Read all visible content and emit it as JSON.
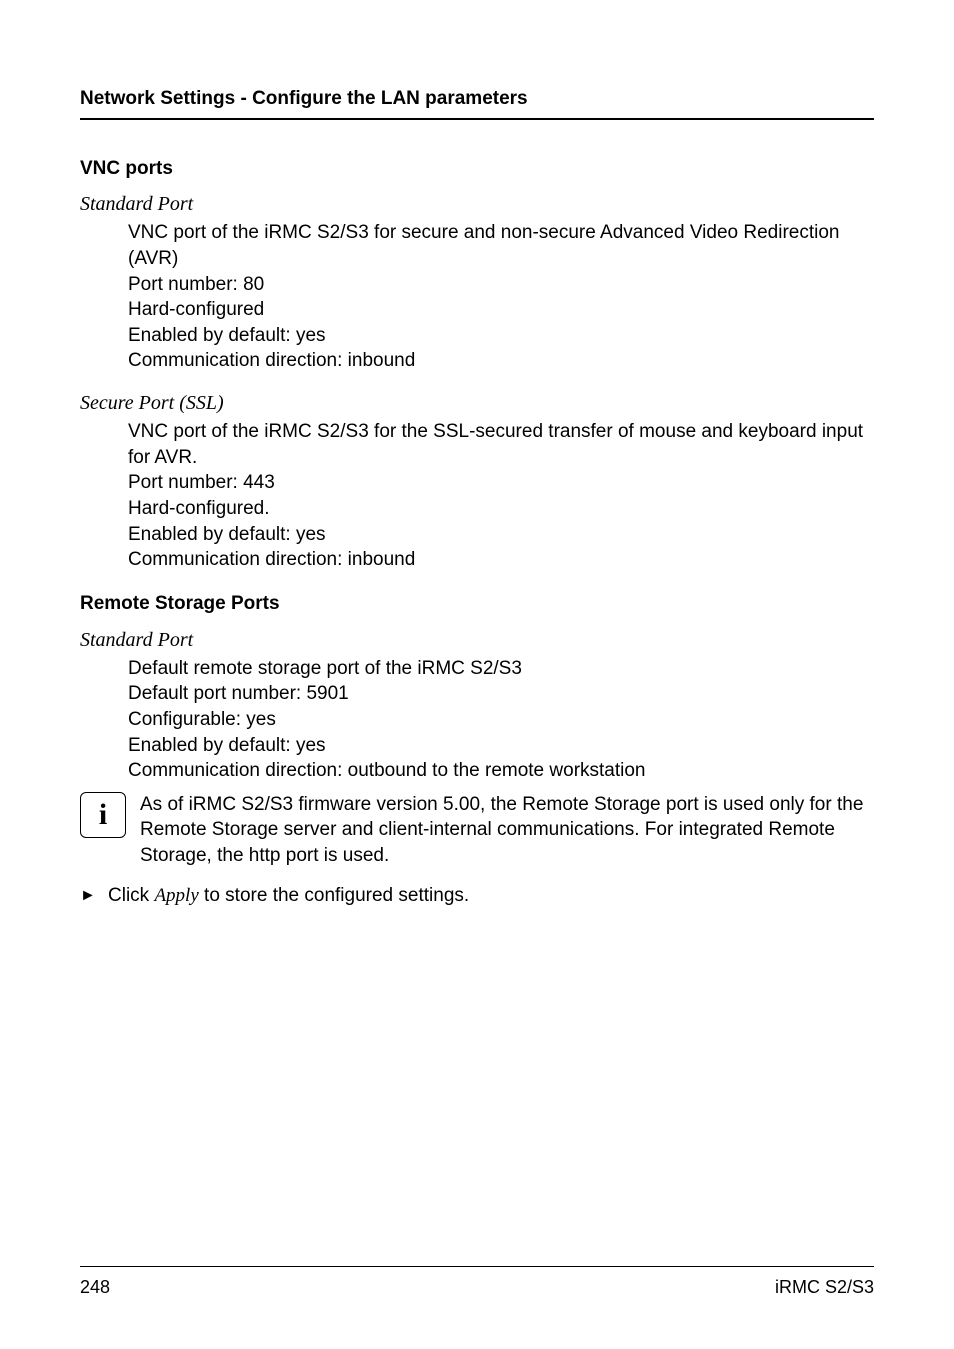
{
  "header": {
    "title": "Network Settings - Configure the LAN parameters"
  },
  "sections": {
    "vnc": {
      "title": "VNC ports",
      "standard": {
        "label": "Standard Port",
        "l1": "VNC port of the iRMC S2/S3 for secure and non-secure Advanced Video Redirection (AVR)",
        "l2": "Port number: 80",
        "l3": "Hard-configured",
        "l4": "Enabled by default: yes",
        "l5": "Communication direction: inbound"
      },
      "secure": {
        "label": "Secure Port (SSL)",
        "l1": "VNC port of the iRMC S2/S3 for the SSL-secured transfer of mouse and keyboard input for AVR.",
        "l2": "Port number: 443",
        "l3": "Hard-configured.",
        "l4": "Enabled by default: yes",
        "l5": "Communication direction: inbound"
      }
    },
    "storage": {
      "title": "Remote Storage Ports",
      "standard": {
        "label": "Standard Port",
        "l1": "Default remote storage port of the iRMC S2/S3",
        "l2": "Default port number: 5901",
        "l3": "Configurable: yes",
        "l4": "Enabled by default: yes",
        "l5": "Communication direction: outbound to the remote workstation"
      }
    }
  },
  "info": {
    "text": "As of iRMC S2/S3 firmware version 5.00, the Remote Storage port is used only for the Remote Storage server and client-internal communications. For integrated Remote Storage, the http port is used."
  },
  "apply": {
    "pre": "Click ",
    "italic": "Apply",
    "post": " to store the configured settings."
  },
  "footer": {
    "page": "248",
    "product": "iRMC S2/S3"
  }
}
